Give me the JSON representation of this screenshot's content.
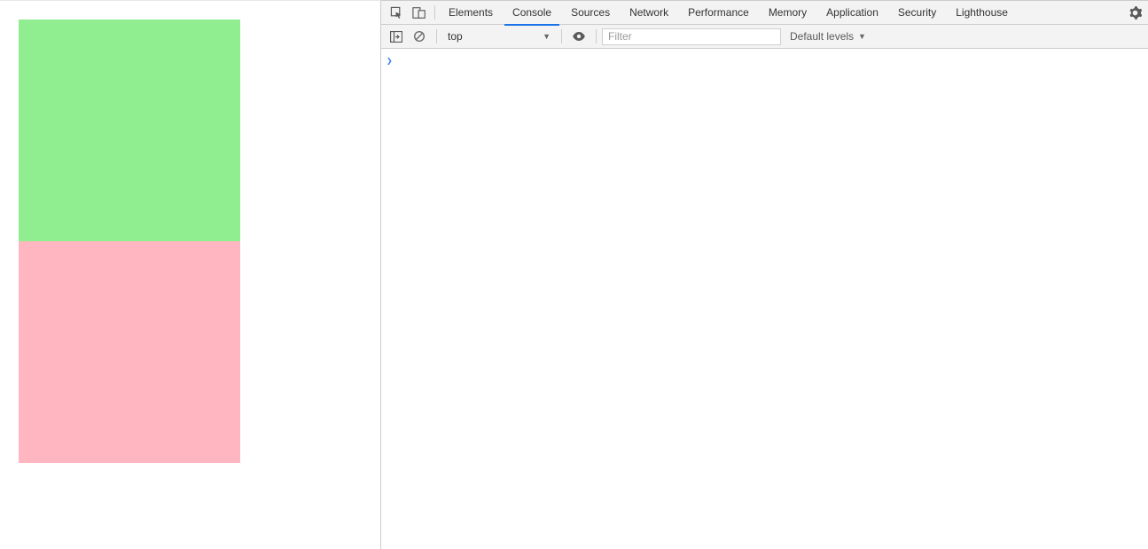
{
  "viewport": {
    "boxes": [
      {
        "name": "box-green",
        "color": "#90ee90"
      },
      {
        "name": "box-pink",
        "color": "#ffb6c1"
      }
    ]
  },
  "devtools": {
    "tabs": [
      {
        "label": "Elements",
        "active": false
      },
      {
        "label": "Console",
        "active": true
      },
      {
        "label": "Sources",
        "active": false
      },
      {
        "label": "Network",
        "active": false
      },
      {
        "label": "Performance",
        "active": false
      },
      {
        "label": "Memory",
        "active": false
      },
      {
        "label": "Application",
        "active": false
      },
      {
        "label": "Security",
        "active": false
      },
      {
        "label": "Lighthouse",
        "active": false
      }
    ],
    "toolbar": {
      "context": "top",
      "filter_placeholder": "Filter",
      "levels_label": "Default levels"
    },
    "prompt": ""
  }
}
